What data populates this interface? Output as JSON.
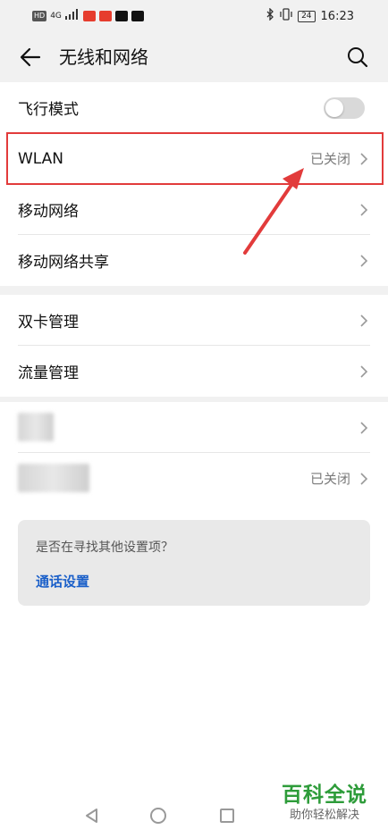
{
  "status_bar": {
    "hd": "HD",
    "network": "4G",
    "time": "16:23",
    "battery": "24"
  },
  "header": {
    "title": "无线和网络"
  },
  "group1": [
    {
      "label": "飞行模式",
      "type": "toggle",
      "on": false
    },
    {
      "label": "WLAN",
      "value": "已关闭",
      "type": "nav",
      "highlighted": true
    },
    {
      "label": "移动网络",
      "value": "",
      "type": "nav"
    },
    {
      "label": "移动网络共享",
      "value": "",
      "type": "nav"
    }
  ],
  "group2": [
    {
      "label": "双卡管理",
      "type": "nav"
    },
    {
      "label": "流量管理",
      "type": "nav"
    }
  ],
  "group3": [
    {
      "value": "",
      "type": "nav",
      "blurred": true
    },
    {
      "value": "已关闭",
      "type": "nav",
      "blurred": true
    }
  ],
  "suggestion": {
    "question": "是否在寻找其他设置项？",
    "link": "通话设置"
  },
  "watermark": {
    "main": "百科全说",
    "sub": "助你轻松解决"
  },
  "colors": {
    "highlight": "#e23b3b",
    "link": "#1a5fc9",
    "watermark": "#2e9c3a"
  }
}
